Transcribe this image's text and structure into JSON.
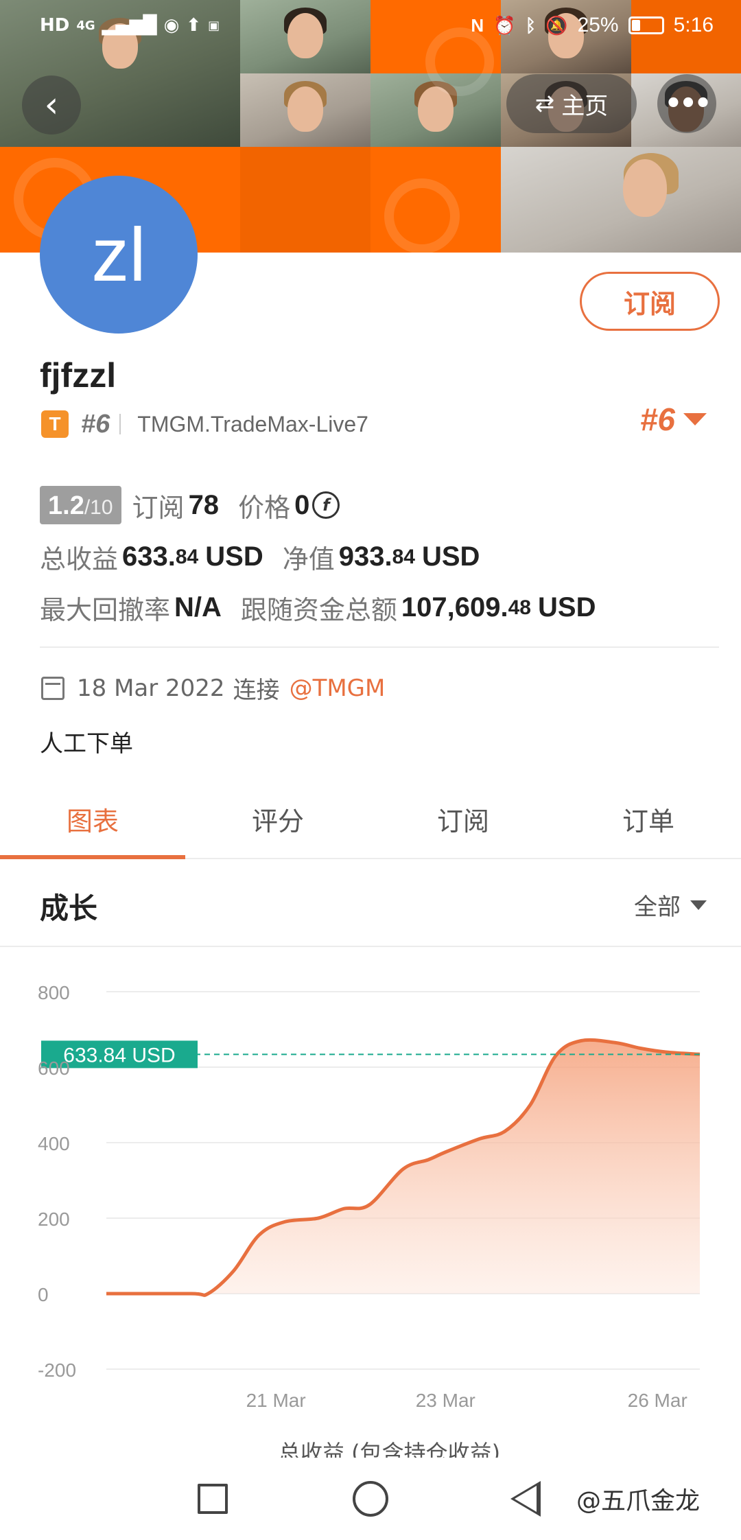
{
  "status_bar": {
    "left_icons": [
      "HD",
      "4G",
      "signal-icon",
      "eye-icon",
      "upload-icon",
      "huawei-icon"
    ],
    "right_icons": [
      "nfc-icon",
      "alarm-icon",
      "bluetooth-icon",
      "mute-icon"
    ],
    "battery": "25%",
    "time": "5:16"
  },
  "header": {
    "back_icon": "chevron-left-icon",
    "home_label": "主页",
    "home_icon": "switch-arrows-icon",
    "more_icon": "more-dots-icon"
  },
  "profile": {
    "avatar_text": "zl",
    "subscribe_label": "订阅",
    "username": "fjfzzl",
    "badge": "T",
    "rank_small": "#6",
    "server": "TMGM.TradeMax-Live7",
    "rank_right": "#6"
  },
  "stats": {
    "score": "1.2",
    "score_max": "/10",
    "subscribe_label": "订阅",
    "subscribe_count": "78",
    "price_label": "价格",
    "price_value": "0",
    "price_icon": "coin-f-icon",
    "profit_label": "总收益",
    "profit_int": "633.",
    "profit_dec": "84",
    "profit_unit": "USD",
    "equity_label": "净值",
    "equity_int": "933.",
    "equity_dec": "84",
    "equity_unit": "USD",
    "drawdown_label": "最大回撤率",
    "drawdown_value": "N/A",
    "follow_label": "跟随资金总额",
    "follow_int": "107,609.",
    "follow_dec": "48",
    "follow_unit": "USD"
  },
  "info": {
    "calendar_icon": "calendar-icon",
    "date": "18 Mar 2022",
    "connect_label": "连接",
    "broker": "@TMGM",
    "description": "人工下单"
  },
  "tabs": [
    "图表",
    "评分",
    "订阅",
    "订单"
  ],
  "section": {
    "title": "成长",
    "filter_label": "全部"
  },
  "chart_data": {
    "type": "area",
    "y_ticks": [
      800,
      600,
      400,
      200,
      0,
      -200
    ],
    "y_tick_labels": [
      "800",
      "600",
      "400",
      "200",
      "0",
      "-200"
    ],
    "ylim": [
      -200,
      800
    ],
    "x_tick_labels": [
      "21 Mar",
      "23 Mar",
      "26 Mar"
    ],
    "x_tick_positions": [
      21,
      23,
      25.5
    ],
    "xlim": [
      19,
      26
    ],
    "series": [
      {
        "name": "总收益 (包含持仓收益)",
        "color": "#e8703f",
        "x": [
          19.0,
          20.0,
          20.2,
          20.5,
          20.8,
          21.1,
          21.5,
          21.8,
          22.1,
          22.5,
          22.8,
          23.0,
          23.4,
          23.7,
          24.0,
          24.3,
          24.6,
          25.0,
          25.3,
          25.6,
          26.0
        ],
        "y": [
          0,
          0,
          0,
          60,
          155,
          190,
          200,
          225,
          235,
          330,
          355,
          375,
          410,
          430,
          500,
          630,
          670,
          665,
          650,
          640,
          634
        ]
      }
    ],
    "reference_line": {
      "value": 633.84,
      "label": "633.84 USD",
      "color": "#1aaa8e"
    },
    "grid": true,
    "legend_position": "bottom"
  },
  "navbar": {
    "square_icon": "recent-apps-icon",
    "circle_icon": "home-circle-icon",
    "back_icon": "back-triangle-icon",
    "watermark": "@五爪金龙"
  },
  "colors": {
    "accent": "#e8703f",
    "banner": "#ff6a00",
    "avatar": "#4f86d6",
    "reference": "#1aaa8e"
  }
}
